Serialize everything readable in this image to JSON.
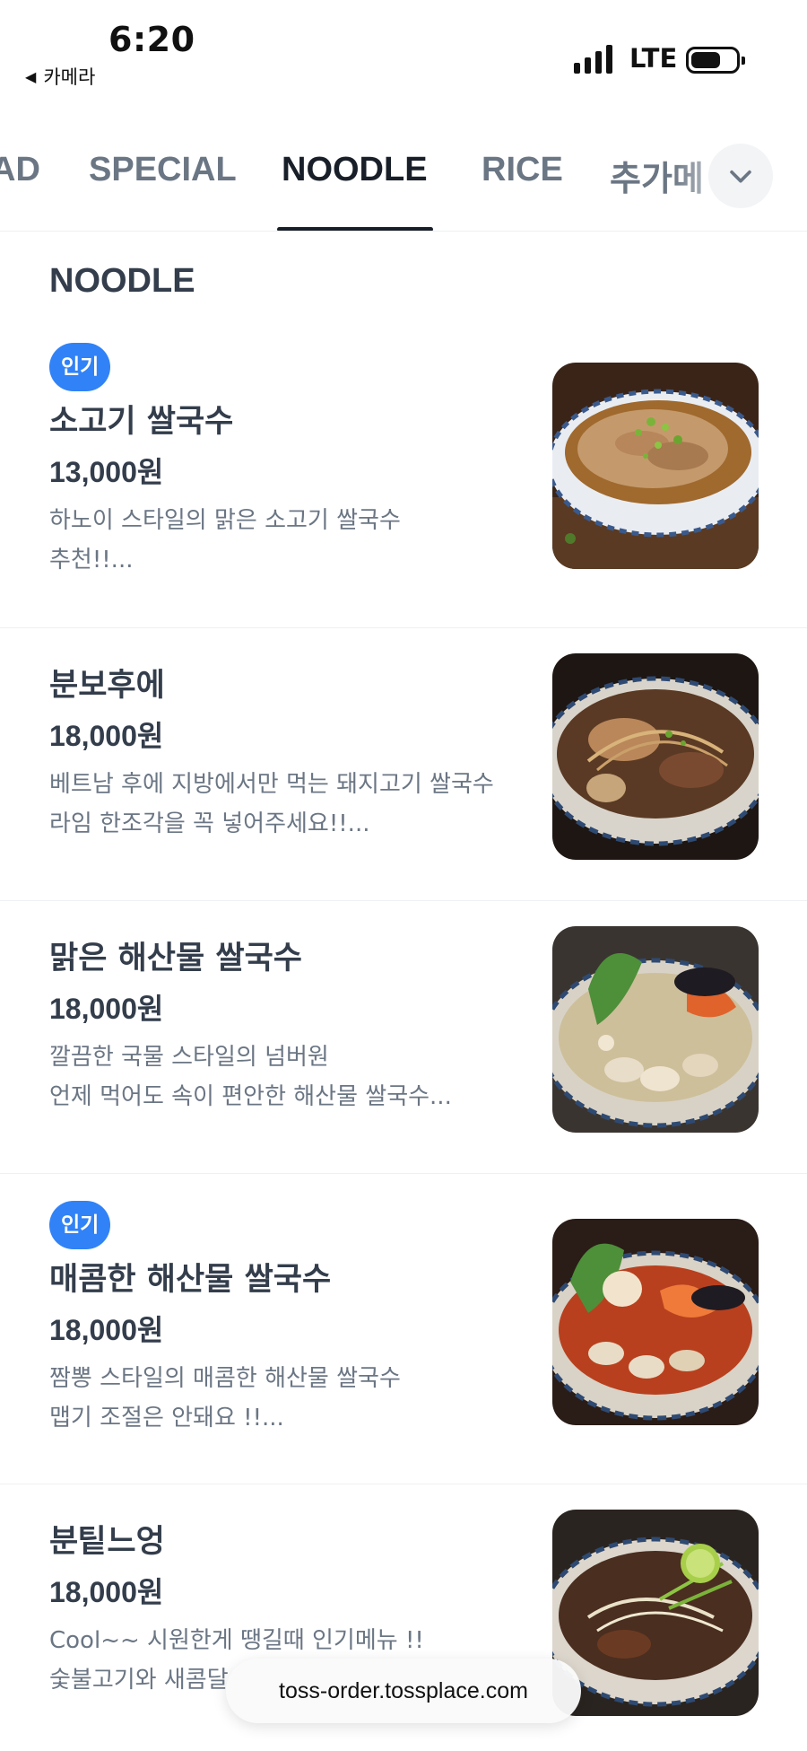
{
  "status_bar": {
    "time": "6:20",
    "back_app": "카메라",
    "network": "LTE"
  },
  "tabs": [
    {
      "label": "AD"
    },
    {
      "label": "SPECIAL"
    },
    {
      "label": "NOODLE",
      "active": true
    },
    {
      "label": "RICE"
    },
    {
      "label": "추가메"
    }
  ],
  "tabs_more_icon": "chevron-down-icon",
  "section": {
    "title": "NOODLE"
  },
  "items": [
    {
      "badge": "인기",
      "name": "소고기 쌀국수",
      "price": "13,000원",
      "desc": "하노이 스타일의 맑은 소고기 쌀국수\n추천!!..."
    },
    {
      "name": "분보후에",
      "price": "18,000원",
      "desc": "베트남 후에 지방에서만 먹는 돼지고기 쌀국수\n라임 한조각을 꼭 넣어주세요!!..."
    },
    {
      "name": "맑은 해산물 쌀국수",
      "price": "18,000원",
      "desc": "깔끔한 국물 스타일의 넘버원\n언제 먹어도 속이 편안한 해산물 쌀국수..."
    },
    {
      "badge": "인기",
      "name": "매콤한 해산물 쌀국수",
      "price": "18,000원",
      "desc": "짬뽕 스타일의 매콤한 해산물 쌀국수\n맵기 조절은 안돼요 !!..."
    },
    {
      "name": "분팉느엉",
      "price": "18,000원",
      "desc": "Cool~~ 시원한게 땡길때 인기메뉴 !!\n숯불고기와 새콤달"
    }
  ],
  "url_bar": {
    "url": "toss-order.tossplace.com"
  },
  "colors": {
    "accent": "#3182f6",
    "text_primary": "#333d4b",
    "text_secondary": "#6b7684",
    "divider": "#eef0f3"
  }
}
